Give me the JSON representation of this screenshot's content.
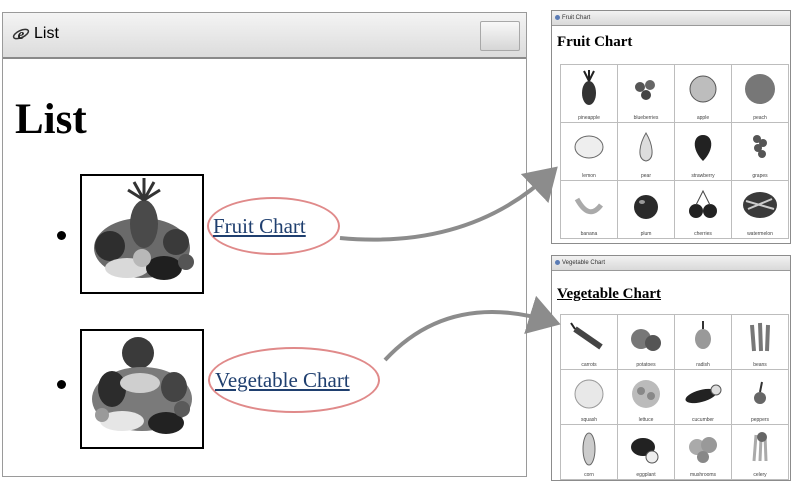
{
  "browser": {
    "tab_title": "List",
    "page_heading": "List"
  },
  "list_items": [
    {
      "link_text": "Fruit Chart"
    },
    {
      "link_text": "Vegetable Chart"
    }
  ],
  "fruit_window": {
    "heading": "Fruit Chart",
    "items": [
      "pineapple",
      "blueberries",
      "apple",
      "peach",
      "lemon",
      "pear",
      "strawberry",
      "grapes",
      "banana",
      "plum",
      "cherries",
      "watermelon"
    ]
  },
  "vegetable_window": {
    "heading": "Vegetable Chart",
    "items": [
      "carrots",
      "potatoes",
      "radish",
      "beans",
      "squash",
      "lettuce",
      "cucumber",
      "peppers",
      "corn",
      "eggplant",
      "mushrooms",
      "celery"
    ]
  },
  "colors": {
    "link": "#1f3f6f",
    "highlight_oval": "#e08a8a",
    "arrow": "#8c8c8c"
  }
}
